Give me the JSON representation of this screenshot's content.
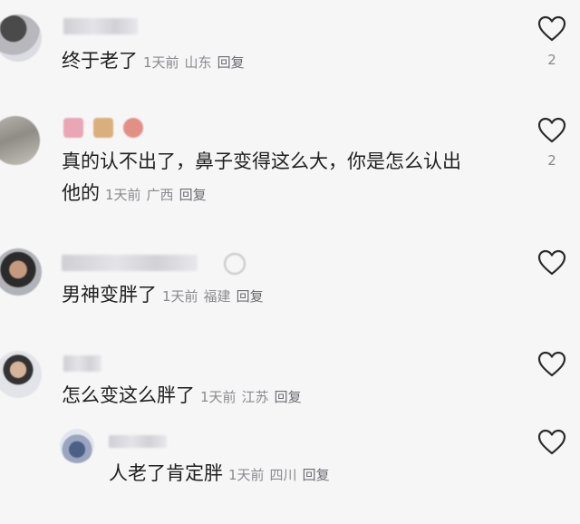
{
  "comments": [
    {
      "text": "终于老了",
      "time": "1天前",
      "location": "山东",
      "reply": "回复",
      "likes": "2"
    },
    {
      "text_line1": "真的认不出了，鼻子变得这么大，你是怎么认出",
      "text_line2": "他的",
      "time": "1天前",
      "location": "广西",
      "reply": "回复",
      "likes": "2"
    },
    {
      "text": "男神变胖了",
      "time": "1天前",
      "location": "福建",
      "reply": "回复",
      "likes": ""
    },
    {
      "text": "怎么变这么胖了",
      "time": "1天前",
      "location": "江苏",
      "reply": "回复",
      "likes": ""
    },
    {
      "text": "人老了肯定胖",
      "time": "1天前",
      "location": "四川",
      "reply": "回复",
      "likes": ""
    }
  ],
  "icons": {
    "like": "heart-outline-icon"
  },
  "colors": {
    "background": "#f6f6f7",
    "text": "#1f1f1f",
    "meta": "#8a8a8f"
  }
}
